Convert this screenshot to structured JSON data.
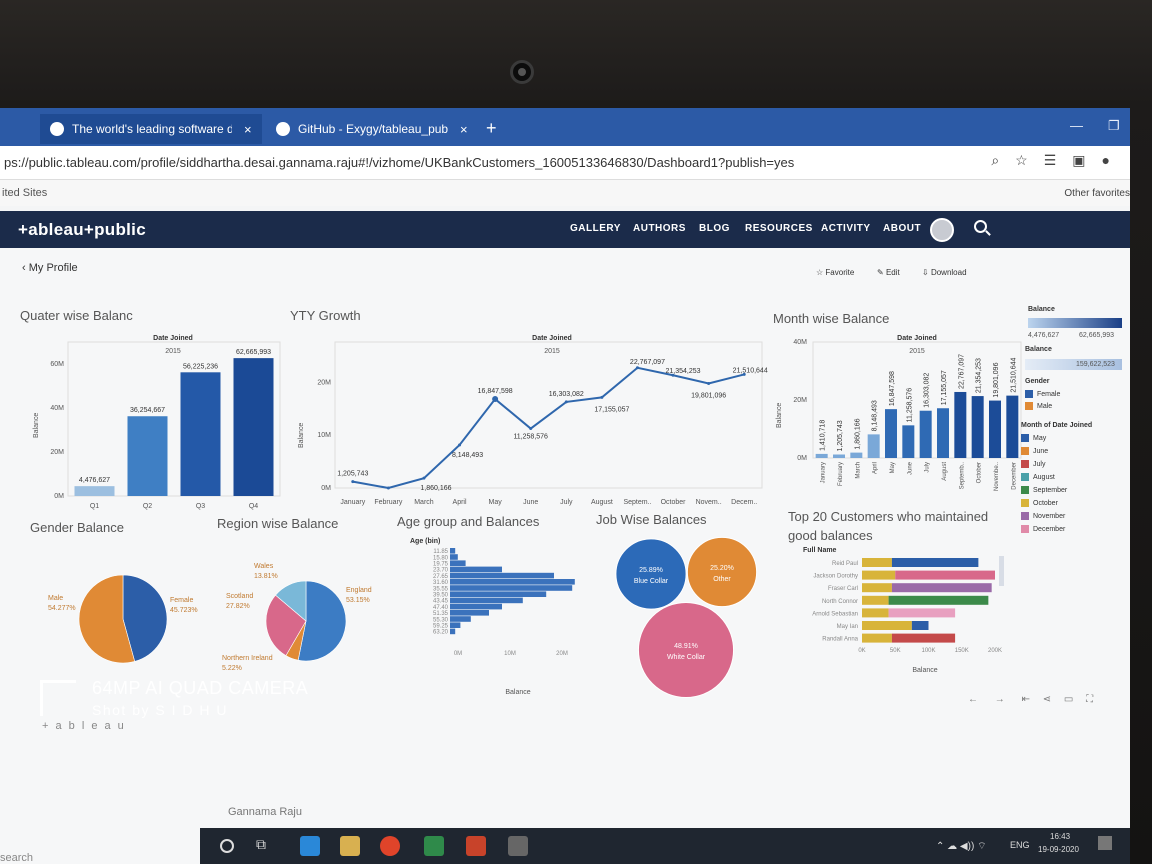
{
  "browser": {
    "tabs": [
      {
        "label": "The world's leading software de",
        "close": "×"
      },
      {
        "label": "GitHub - Exygy/tableau_public:",
        "close": "×"
      }
    ],
    "new_tab": "+",
    "url": "ps://public.tableau.com/profile/siddhartha.desai.gannama.raju#!/vizhome/UKBankCustomers_16005133646830/Dashboard1?publish=yes",
    "favorites_left": "ited Sites",
    "favorites_right": "Other favorites"
  },
  "tableau": {
    "logo": "+ableau+public",
    "nav": [
      "GALLERY",
      "AUTHORS",
      "BLOG",
      "RESOURCES",
      "ACTIVITY",
      "ABOUT"
    ],
    "back": "My Profile",
    "actions": {
      "favorite": "Favorite",
      "edit": "Edit",
      "download": "Download"
    },
    "footer_logo": "+ a b l e a u"
  },
  "charts": {
    "quarter": {
      "title": "Quater wise Balanc",
      "header": "Date Joined",
      "year": "2015",
      "ylabel": "Balance",
      "yticks": [
        "0M",
        "20M",
        "40M",
        "60M"
      ]
    },
    "yty": {
      "title": "YTY Growth",
      "header": "Date Joined",
      "year": "2015",
      "ylabel": "Balance",
      "yticks": [
        "0M",
        "10M",
        "20M"
      ]
    },
    "month": {
      "title": "Month wise Balance",
      "header": "Date Joined",
      "year": "2015",
      "ylabel": "Balance",
      "yticks": [
        "0M",
        "20M",
        "40M"
      ]
    },
    "gender": {
      "title": "Gender Balance"
    },
    "region": {
      "title": "Region wise Balance"
    },
    "age": {
      "title": "Age group and Balances",
      "header": "Age (bin)",
      "xlabel": "Balance",
      "xticks": [
        "0M",
        "10M",
        "20M"
      ]
    },
    "job": {
      "title": "Job Wise Balances"
    },
    "top20": {
      "title1": "Top 20 Customers who maintained",
      "title2": "good balances",
      "header": "Full Name",
      "xlabel": "Balance",
      "xticks": [
        "0K",
        "50K",
        "100K",
        "150K",
        "200K"
      ]
    }
  },
  "legend": {
    "balance_title": "Balance",
    "balance_min": "4,476,627",
    "balance_max": "62,665,993",
    "balance2_title": "Balance",
    "balance2_value": "159,622,523",
    "gender_title": "Gender",
    "gender_items": [
      {
        "label": "Female",
        "color": "#2c5ea8"
      },
      {
        "label": "Male",
        "color": "#e08a35"
      }
    ],
    "month_title": "Month of Date Joined",
    "month_items": [
      {
        "label": "May",
        "color": "#2c5ea8"
      },
      {
        "label": "June",
        "color": "#e08a35"
      },
      {
        "label": "July",
        "color": "#c44a4a"
      },
      {
        "label": "August",
        "color": "#4aa0a8"
      },
      {
        "label": "September",
        "color": "#3c8a4a"
      },
      {
        "label": "October",
        "color": "#d8b43a"
      },
      {
        "label": "November",
        "color": "#9a6aa8"
      },
      {
        "label": "December",
        "color": "#e08aa8"
      }
    ]
  },
  "chart_data": [
    {
      "type": "bar",
      "title": "Quater wise Balanc",
      "categories": [
        "Q1",
        "Q2",
        "Q3",
        "Q4"
      ],
      "values": [
        4476627,
        36254667,
        56225236,
        62665993
      ],
      "labels": [
        "4,476,627",
        "36,254,667",
        "56,225,236",
        "62,665,993"
      ],
      "ylabel": "Balance",
      "ylim": [
        0,
        70000000
      ]
    },
    {
      "type": "line",
      "title": "YTY Growth",
      "categories": [
        "January",
        "February",
        "March",
        "April",
        "May",
        "June",
        "July",
        "August",
        "Septem..",
        "October",
        "Novem..",
        "Decem.."
      ],
      "values": [
        1205743,
        0,
        1860166,
        8148493,
        16847598,
        11258576,
        16303082,
        17155057,
        22767097,
        21354253,
        19801096,
        21510644
      ],
      "labels": [
        "1,205,743",
        "",
        "1,860,166",
        "8,148,493",
        "16,847,598",
        "11,258,576",
        "16,303,082",
        "17,155,057",
        "22,767,097",
        "21,354,253",
        "19,801,096",
        "21,510,644"
      ],
      "ylabel": "Balance",
      "ylim": [
        0,
        25000000
      ]
    },
    {
      "type": "bar",
      "title": "Month wise Balance",
      "categories": [
        "January",
        "February",
        "March",
        "April",
        "May",
        "June",
        "July",
        "August",
        "Septemb..",
        "October",
        "Novembe..",
        "December"
      ],
      "values": [
        1410718,
        1205743,
        1860166,
        8148493,
        16847598,
        11258576,
        16303082,
        17155057,
        22767097,
        21354253,
        19801096,
        21510644
      ],
      "labels": [
        "1,410,718",
        "1,205,743",
        "1,860,166",
        "8,148,493",
        "16,847,598",
        "11,258,576",
        "16,303,082",
        "17,155,057",
        "22,767,097",
        "21,354,253",
        "19,801,096",
        "21,510,644"
      ],
      "ylabel": "Balance",
      "ylim": [
        0,
        40000000
      ]
    },
    {
      "type": "pie",
      "title": "Gender Balance",
      "slices": [
        {
          "label": "Female",
          "pct": "45.723%",
          "value": 45.723,
          "color": "#2c5ea8"
        },
        {
          "label": "Male",
          "pct": "54.277%",
          "value": 54.277,
          "color": "#e08a35"
        }
      ]
    },
    {
      "type": "pie",
      "title": "Region wise Balance",
      "slices": [
        {
          "label": "England",
          "pct": "53.15%",
          "value": 53.15,
          "color": "#3c7cc4"
        },
        {
          "label": "Northern Ireland",
          "pct": "5.22%",
          "value": 5.22,
          "color": "#e08a35"
        },
        {
          "label": "Scotland",
          "pct": "27.82%",
          "value": 27.82,
          "color": "#d8688a"
        },
        {
          "label": "Wales",
          "pct": "13.81%",
          "value": 13.81,
          "color": "#7ab8d8"
        }
      ]
    },
    {
      "type": "bar",
      "orientation": "horizontal",
      "title": "Age group and Balances",
      "categories": [
        "11.85",
        "15.80",
        "19.75",
        "23.70",
        "27.65",
        "31.60",
        "35.55",
        "39.50",
        "43.45",
        "47.40",
        "51.35",
        "55.30",
        "59.25",
        "63.20"
      ],
      "values": [
        1000000,
        1500000,
        3000000,
        10000000,
        20000000,
        24000000,
        23500000,
        18500000,
        14000000,
        10000000,
        7500000,
        4000000,
        2000000,
        1000000
      ],
      "xlabel": "Balance",
      "xlim": [
        0,
        25000000
      ]
    },
    {
      "type": "bubble",
      "title": "Job Wise Balances",
      "items": [
        {
          "label": "Blue Collar",
          "pct": "25.89%",
          "value": 25.89,
          "color": "#2c6ab8"
        },
        {
          "label": "Other",
          "pct": "25.20%",
          "value": 25.2,
          "color": "#e08a35"
        },
        {
          "label": "White Collar",
          "pct": "48.91%",
          "value": 48.91,
          "color": "#d8688a"
        }
      ]
    },
    {
      "type": "bar",
      "orientation": "horizontal",
      "stacked": true,
      "title": "Top 20 Customers who maintained good balances",
      "categories": [
        "Reid Paul",
        "Jackson Dorothy",
        "Fraser Carl",
        "North Connor",
        "Arnold Sebastian",
        "May Ian",
        "Randall Anna"
      ],
      "series": [
        {
          "color": "#d8b43a",
          "values": [
            45000,
            50000,
            45000,
            40000,
            40000,
            75000,
            45000
          ]
        },
        {
          "color": "#2c5ea8",
          "values": [
            130000,
            0,
            0,
            0,
            0,
            25000,
            0
          ]
        },
        {
          "color": "#d8688a",
          "values": [
            0,
            150000,
            0,
            0,
            0,
            0,
            0
          ]
        },
        {
          "color": "#9a6aa8",
          "values": [
            0,
            0,
            150000,
            0,
            0,
            0,
            0
          ]
        },
        {
          "color": "#3c8a4a",
          "values": [
            0,
            0,
            0,
            150000,
            0,
            0,
            0
          ]
        },
        {
          "color": "#e8a0c0",
          "values": [
            0,
            0,
            0,
            0,
            100000,
            0,
            0
          ]
        },
        {
          "color": "#c44a4a",
          "values": [
            0,
            0,
            0,
            0,
            0,
            0,
            95000
          ]
        }
      ],
      "xlabel": "Balance",
      "xlim": [
        0,
        200000
      ]
    }
  ],
  "taskbar": {
    "lang": "ENG",
    "time": "16:43",
    "date": "19-09-2020",
    "search": "search"
  },
  "watermark": {
    "line1": "64MP AI QUAD CAMERA",
    "line2": "Shot by S I D H U",
    "behind": "Gannama Raju"
  }
}
